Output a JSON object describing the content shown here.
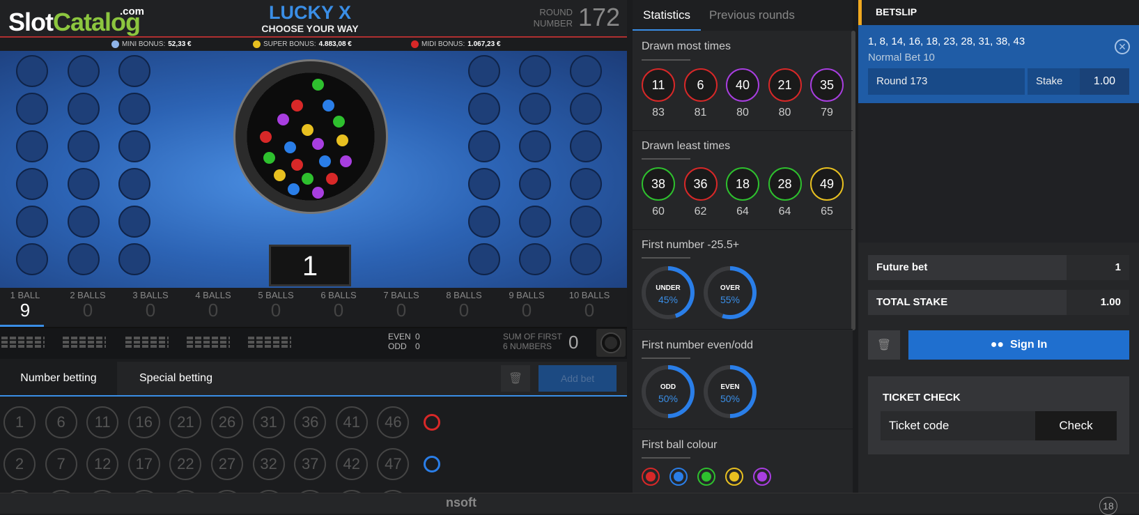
{
  "header": {
    "logo_main": "Slot",
    "logo_accent": "Catalog",
    "logo_com": ".com",
    "title": "LUCKY X",
    "subtitle": "CHOOSE YOUR WAY",
    "round_label": "ROUND NUMBER",
    "round_number": "172"
  },
  "bonuses": [
    {
      "name": "MINI BONUS:",
      "value": "52,33 €",
      "color": "#8fb4e8"
    },
    {
      "name": "SUPER BONUS:",
      "value": "4.883,08 €",
      "color": "#e8c020"
    },
    {
      "name": "MIDI BONUS:",
      "value": "1.067,23 €",
      "color": "#d82828"
    }
  ],
  "drawn_number": "1",
  "ball_counts": [
    {
      "label": "1 BALL",
      "value": "9"
    },
    {
      "label": "2 BALLS",
      "value": "0"
    },
    {
      "label": "3 BALLS",
      "value": "0"
    },
    {
      "label": "4 BALLS",
      "value": "0"
    },
    {
      "label": "5 BALLS",
      "value": "0"
    },
    {
      "label": "6 BALLS",
      "value": "0"
    },
    {
      "label": "7 BALLS",
      "value": "0"
    },
    {
      "label": "8 BALLS",
      "value": "0"
    },
    {
      "label": "9 BALLS",
      "value": "0"
    },
    {
      "label": "10 BALLS",
      "value": "0"
    }
  ],
  "even_odd": {
    "even_label": "EVEN",
    "even_value": "0",
    "odd_label": "ODD",
    "odd_value": "0"
  },
  "sum": {
    "label1": "SUM OF FIRST",
    "label2": "6 NUMBERS",
    "value": "0"
  },
  "betting": {
    "tab_number": "Number betting",
    "tab_special": "Special betting",
    "add_bet": "Add bet",
    "row1": [
      "1",
      "6",
      "11",
      "16",
      "21",
      "26",
      "31",
      "36",
      "41",
      "46"
    ],
    "row2": [
      "2",
      "7",
      "12",
      "17",
      "22",
      "27",
      "32",
      "37",
      "42",
      "47"
    ],
    "row1_color": "#d82828",
    "row2_color": "#2a7ee8"
  },
  "stats": {
    "tab_stats": "Statistics",
    "tab_prev": "Previous rounds",
    "most_title": "Drawn most times",
    "most": [
      {
        "n": "11",
        "c": "83",
        "color": "#d82828"
      },
      {
        "n": "6",
        "c": "81",
        "color": "#d82828"
      },
      {
        "n": "40",
        "c": "80",
        "color": "#a83ee0"
      },
      {
        "n": "21",
        "c": "80",
        "color": "#d82828"
      },
      {
        "n": "35",
        "c": "79",
        "color": "#a83ee0"
      }
    ],
    "least_title": "Drawn least times",
    "least": [
      {
        "n": "38",
        "c": "60",
        "color": "#2ec02e"
      },
      {
        "n": "36",
        "c": "62",
        "color": "#d82828"
      },
      {
        "n": "18",
        "c": "64",
        "color": "#2ec02e"
      },
      {
        "n": "28",
        "c": "64",
        "color": "#2ec02e"
      },
      {
        "n": "49",
        "c": "65",
        "color": "#e8c020"
      }
    ],
    "first_title": "First number -25.5+",
    "first": [
      {
        "label": "UNDER",
        "pct": "45%",
        "fraction": 0.45
      },
      {
        "label": "OVER",
        "pct": "55%",
        "fraction": 0.55
      }
    ],
    "eo_title": "First number even/odd",
    "eo": [
      {
        "label": "ODD",
        "pct": "50%",
        "fraction": 0.5
      },
      {
        "label": "EVEN",
        "pct": "50%",
        "fraction": 0.5
      }
    ],
    "colour_title": "First ball colour",
    "colours": [
      "#d82828",
      "#2a7ee8",
      "#2ec02e",
      "#e8c020",
      "#a83ee0"
    ]
  },
  "betslip": {
    "title": "BETSLIP",
    "numbers": "1, 8, 14, 16, 18, 23, 28, 31, 38, 43",
    "bet_type": "Normal Bet 10",
    "round": "Round 173",
    "stake_label": "Stake",
    "stake_value": "1.00",
    "future_label": "Future bet",
    "future_value": "1",
    "total_label": "TOTAL STAKE",
    "total_value": "1.00",
    "signin": "Sign In",
    "ticket_title": "TICKET CHECK",
    "ticket_placeholder": "Ticket code",
    "check": "Check"
  },
  "footer": {
    "brand": "nsoft",
    "age": "18"
  }
}
